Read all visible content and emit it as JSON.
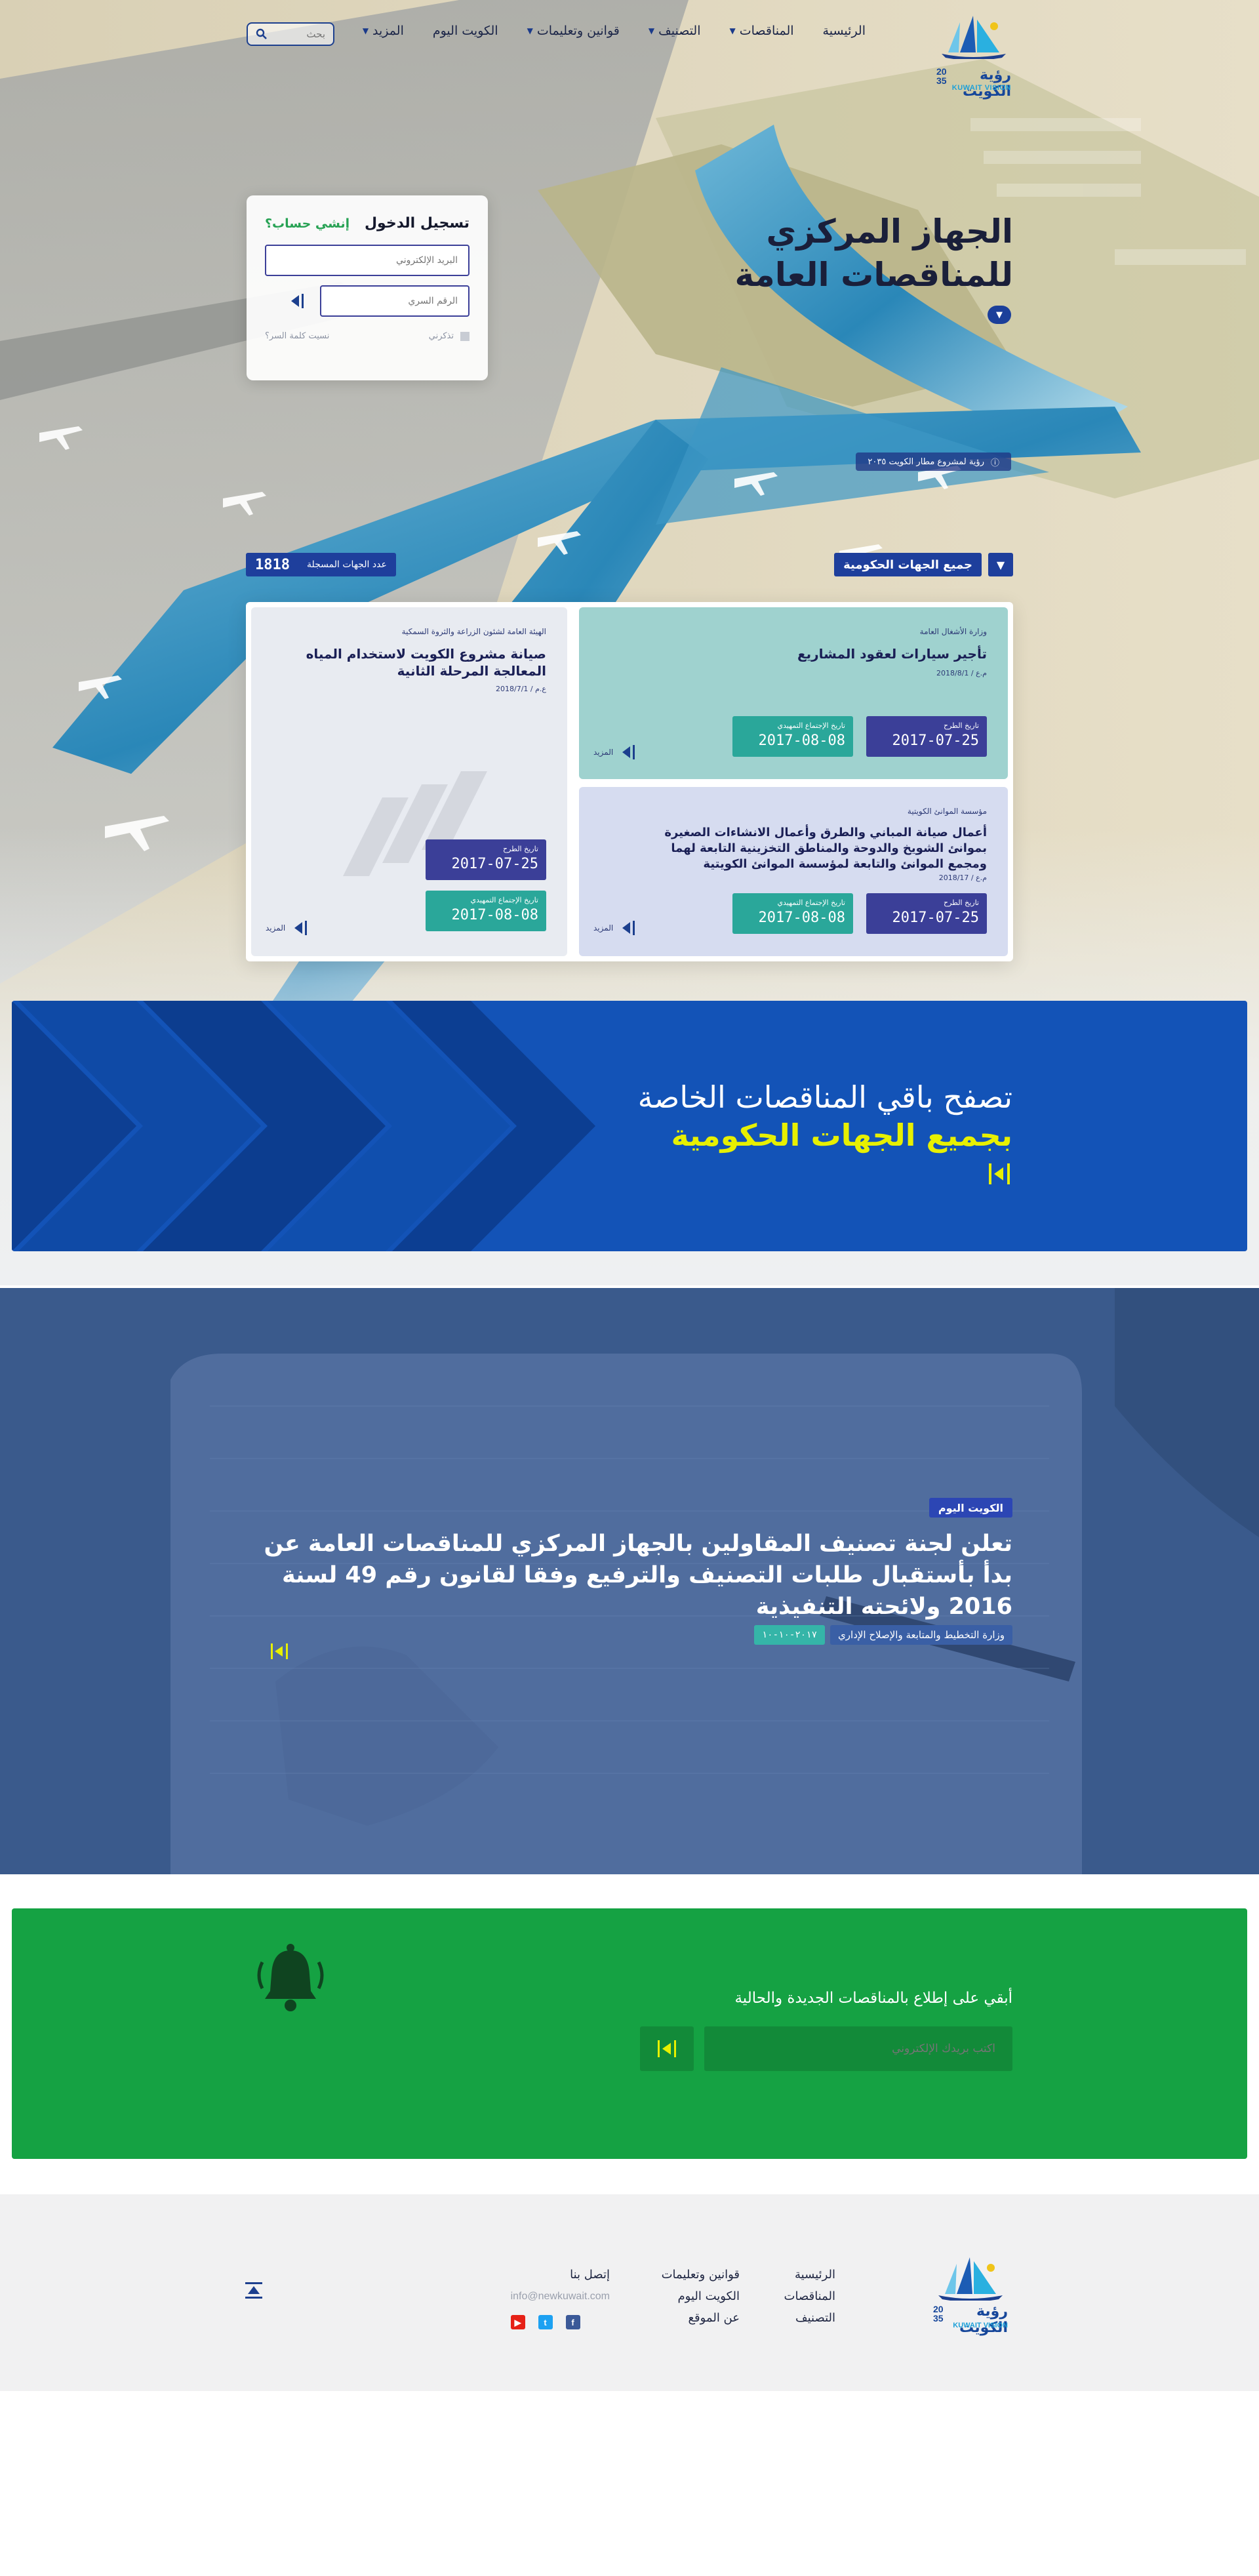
{
  "logo": {
    "arabic": "رؤية الكويت",
    "year_top": "20",
    "year_bottom": "35",
    "english": "KUWAIT VISION"
  },
  "nav": {
    "items": [
      {
        "label": "الرئيسية",
        "has_caret": false
      },
      {
        "label": "المناقصات",
        "has_caret": true
      },
      {
        "label": "التصنيف",
        "has_caret": true
      },
      {
        "label": "قوانين وتعليمات",
        "has_caret": true
      },
      {
        "label": "الكويت اليوم",
        "has_caret": false
      },
      {
        "label": "المزيد",
        "has_caret": true
      }
    ],
    "search_placeholder": "بحث"
  },
  "hero": {
    "title_line1": "الجهاز المركزي",
    "title_line2": "للمناقصات العامة",
    "caption": "رؤية لمشروع مطار الكويت ٢٠٣٥"
  },
  "login": {
    "title": "تسجيل الدخول",
    "signup": "إنشي حساب؟",
    "email_placeholder": "البريد الإلكتروني",
    "password_placeholder": "الرقم السري",
    "remember": "تذكرني",
    "forgot": "نسيت كلمة السر؟"
  },
  "tenders": {
    "filter_label": "جميع الجهات الحكومية",
    "registered_count": "1818",
    "registered_label": "عدد الجهات المسجلة",
    "more_label": "المزيد",
    "offer_label": "تاريخ الطرح",
    "meeting_label": "تاريخ الإجتماع التمهيدي",
    "cards": [
      {
        "org": "وزارة الأشغال العامة",
        "title": "تأجير سيارات لعقود المشاريع",
        "ref": "م.ع / 2018/8/1",
        "offer_date": "2017-07-25",
        "meeting_date": "2017-08-08"
      },
      {
        "org": "الهيئة العامة لشئون الزراعة والثروة السمكية",
        "title": "صيانة مشروع الكويت لاستخدام المياه المعالجة المرحلة الثانية",
        "ref": "ع.م / 2018/7/1",
        "offer_date": "2017-07-25",
        "meeting_date": "2017-08-08"
      },
      {
        "org": "مؤسسة الموانئ الكويتية",
        "title": "أعمال صيانة المباني والطرق وأعمال الانشاءات الصغيرة بموانئ الشويخ والدوحة والمناطق التخزينية التابعة لهما ومجمع الموانئ والتابعة لمؤسسة الموانئ الكويتية",
        "ref": "م.ع / 2018/17",
        "offer_date": "2017-07-25",
        "meeting_date": "2017-08-08"
      }
    ]
  },
  "browse": {
    "line1": "تصفح باقي المناقصات الخاصة",
    "line2": "بجميع الجهات الحكومية"
  },
  "news": {
    "tag": "الكويت اليوم",
    "headline": "تعلن لجنة تصنيف المقاولين بالجهاز المركزي للمناقصات العامة عن بدأ بأستقبال طلبات التصنيف والترفيع وفقا لقانون رقم 49 لسنة 2016 ولائحته التنفيذية",
    "source": "وزارة التخطيط والمتابعة والإصلاح الإداري",
    "date": "٢٠١٧-١٠-١٠"
  },
  "subscribe": {
    "title": "أبقي على إطلاع بالمناقصات الجديدة والحالية",
    "email_placeholder": "اكتب بريدك الإلكتروني"
  },
  "footer": {
    "col1": [
      "الرئيسية",
      "المناقصات",
      "التصنيف"
    ],
    "col2": [
      "قوانين وتعليمات",
      "الكويت اليوم",
      "عن الموقع"
    ],
    "contact_title": "إتصل بنا",
    "email": "info@newkuwait.com",
    "social": [
      {
        "name": "facebook",
        "color": "#3b5998"
      },
      {
        "name": "twitter",
        "color": "#1da1f2"
      },
      {
        "name": "youtube",
        "color": "#e62117"
      }
    ]
  }
}
